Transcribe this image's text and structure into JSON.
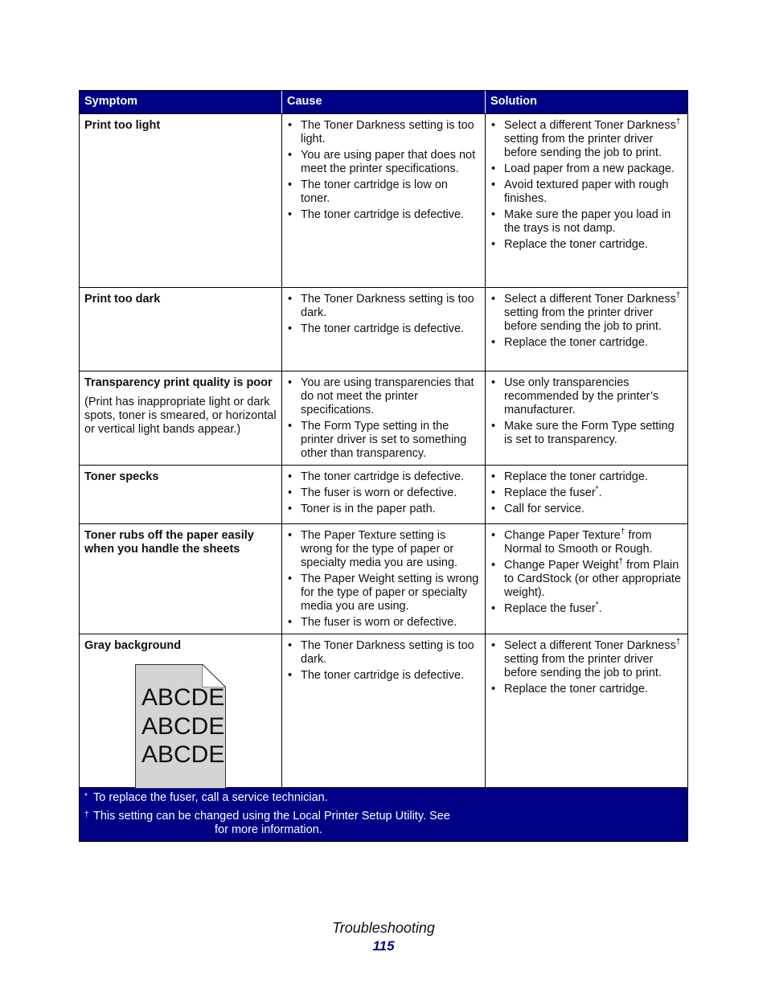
{
  "table": {
    "headers": [
      "Symptom",
      "Cause",
      "Solution"
    ],
    "rows": [
      {
        "symptom": "Print too light",
        "causes": [
          "The Toner Darkness setting is too light.",
          "You are using paper that does not meet the printer specifications.",
          "The toner cartridge is low on toner.",
          "The toner cartridge is defective."
        ],
        "solutions": [
          {
            "pre": "Select a different Toner Darkness",
            "mark": "†",
            "post": " setting from the printer driver before sending the job to print."
          },
          {
            "pre": "Load paper from a new package.",
            "mark": "",
            "post": ""
          },
          {
            "pre": "Avoid textured paper with rough finishes.",
            "mark": "",
            "post": ""
          },
          {
            "pre": "Make sure the paper you load in the trays is not damp.",
            "mark": "",
            "post": ""
          },
          {
            "pre": "Replace the toner cartridge.",
            "mark": "",
            "post": ""
          }
        ]
      },
      {
        "symptom": "Print too dark",
        "causes": [
          "The Toner Darkness setting is too dark.",
          "The toner cartridge is defective."
        ],
        "solutions": [
          {
            "pre": "Select a different Toner Darkness",
            "mark": "†",
            "post": " setting from the printer driver before sending the job to print."
          },
          {
            "pre": "Replace the toner cartridge.",
            "mark": "",
            "post": ""
          }
        ]
      },
      {
        "symptom": "Transparency print quality is poor",
        "symptom_note": "(Print has inappropriate light or dark spots, toner is smeared, or horizontal or vertical light bands appear.)",
        "causes": [
          "You are using transparencies that do not meet the printer specifications.",
          "The Form Type setting in the printer driver is set to something other than transparency."
        ],
        "solutions": [
          {
            "pre": "Use only transparencies recommended by the printer’s manufacturer.",
            "mark": "",
            "post": ""
          },
          {
            "pre": "Make sure the Form Type setting is set to transparency.",
            "mark": "",
            "post": ""
          }
        ]
      },
      {
        "symptom": "Toner specks",
        "causes": [
          "The toner cartridge is defective.",
          "The fuser is worn or defective.",
          "Toner is in the paper path."
        ],
        "solutions": [
          {
            "pre": "Replace the toner cartridge.",
            "mark": "",
            "post": ""
          },
          {
            "pre": "Replace the fuser",
            "mark": "*",
            "post": "."
          },
          {
            "pre": "Call for service.",
            "mark": "",
            "post": ""
          }
        ]
      },
      {
        "symptom": "Toner rubs off the paper easily when you handle the sheets",
        "causes": [
          "The Paper Texture setting is wrong for the type of paper or specialty media you are using.",
          "The Paper Weight setting is wrong for the type of paper or specialty media you are using.",
          "The fuser is worn or defective."
        ],
        "solutions": [
          {
            "pre": "Change Paper Texture",
            "mark": "†",
            "post": " from Normal to Smooth or Rough."
          },
          {
            "pre": "Change Paper Weight",
            "mark": "†",
            "post": " from Plain to CardStock (or other appropriate weight)."
          },
          {
            "pre": "Replace the fuser",
            "mark": "*",
            "post": "."
          }
        ]
      },
      {
        "symptom": "Gray background",
        "sample_lines": [
          "ABCDE",
          "ABCDE",
          "ABCDE"
        ],
        "causes": [
          "The Toner Darkness setting is too dark.",
          "The toner cartridge is defective."
        ],
        "solutions": [
          {
            "pre": "Select a different Toner Darkness",
            "mark": "†",
            "post": " setting from the printer driver before sending the job to print."
          },
          {
            "pre": "Replace the toner cartridge.",
            "mark": "",
            "post": ""
          }
        ]
      }
    ],
    "footnotes": [
      {
        "mark": "*",
        "text": "To replace the fuser, call a service technician."
      },
      {
        "mark": "†",
        "text": "This setting can be changed using the Local Printer Setup Utility. See",
        "continuation": "for more information."
      }
    ]
  },
  "colors": {
    "header_bg": "#000087",
    "page_number": "#000087"
  },
  "page_footer": {
    "section": "Troubleshooting",
    "page_number": "115"
  }
}
